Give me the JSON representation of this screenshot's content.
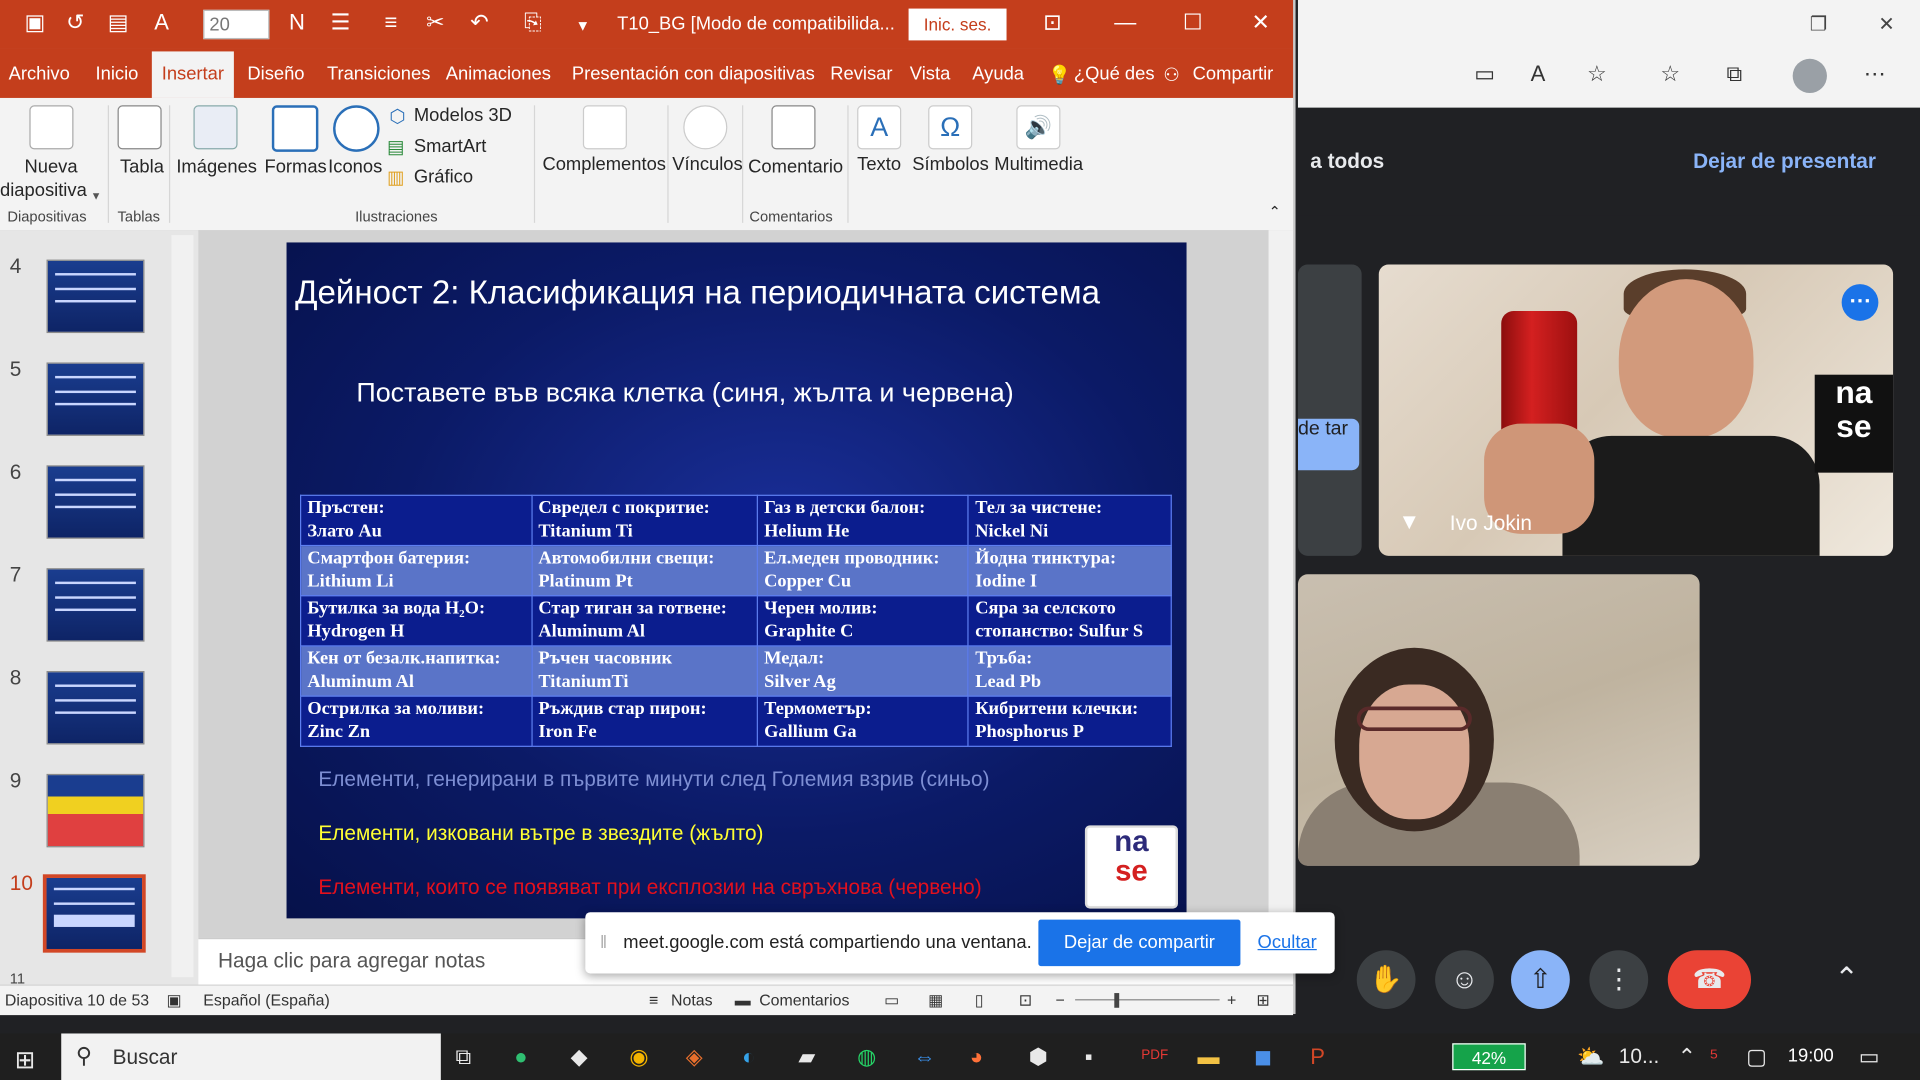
{
  "ppt": {
    "font_size": "20",
    "doc_title": "T10_BG [Modo de compatibilida...",
    "sign_in": "Inic. ses.",
    "tabs": [
      "Archivo",
      "Inicio",
      "Insertar",
      "Diseño",
      "Transiciones",
      "Animaciones",
      "Presentación con diapositivas",
      "Revisar",
      "Vista",
      "Ayuda"
    ],
    "tell_me": "¿Qué des",
    "share": "Compartir",
    "ribbon": {
      "new_slide_1": "Nueva",
      "new_slide_2": "diapositiva",
      "table": "Tabla",
      "images": "Imágenes",
      "shapes": "Formas",
      "icons": "Iconos",
      "models_3d": "Modelos 3D",
      "smartart": "SmartArt",
      "chart": "Gráfico",
      "addins": "Complementos",
      "links": "Vínculos",
      "comment": "Comentario",
      "text": "Texto",
      "symbols": "Símbolos",
      "media": "Multimedia",
      "groups": {
        "slides": "Diapositivas",
        "tables": "Tablas",
        "illustrations": "Ilustraciones",
        "comments": "Comentarios"
      }
    },
    "thumb_numbers": [
      "4",
      "5",
      "6",
      "7",
      "8",
      "9",
      "10",
      "11"
    ],
    "notes_placeholder": "Haga clic para agregar notas",
    "status": {
      "slide_of": "Diapositiva 10 de 53",
      "language": "Español (España)",
      "notes": "Notas",
      "comments": "Comentarios"
    }
  },
  "slide": {
    "title": "Дейност 2: Класификация на периодичната система",
    "subtitle": "Поставете във всяка клетка (синя, жълта и червена)",
    "rows": [
      [
        [
          "Пръстен:",
          "Злато Au"
        ],
        [
          "Свредел с покритие:",
          "Titanium Ti"
        ],
        [
          "Газ в детски балон:",
          "Helium He"
        ],
        [
          "Тел за чистене:",
          "Nickel Ni"
        ]
      ],
      [
        [
          "Смартфон батерия:",
          "Lithium Li"
        ],
        [
          "Автомобилни свещи:",
          "Platinum Pt"
        ],
        [
          "Ел.меден проводник:",
          "Copper Cu"
        ],
        [
          "Йодна тинктура:",
          "Iodine I"
        ]
      ],
      [
        [
          "Бутилка за вода H₂O:",
          "Hydrogen H"
        ],
        [
          "Стар тиган за готвене:",
          "Aluminum Al"
        ],
        [
          "Черен молив:",
          "Graphite C"
        ],
        [
          "Сяра за селското",
          "стопанство: Sulfur  S"
        ]
      ],
      [
        [
          "Кен от безалк.напитка:",
          "Aluminum Al"
        ],
        [
          "Ръчен часовник",
          "TitaniumTi"
        ],
        [
          "Медал:",
          "Silver Ag"
        ],
        [
          "Тръба:",
          "Lead Pb"
        ]
      ],
      [
        [
          "Острилка за моливи:",
          "Zinc Zn"
        ],
        [
          "Ръждив стар пирон:",
          "Iron Fe"
        ],
        [
          "Термометър:",
          "Gallium Ga"
        ],
        [
          "Кибритени клечки:",
          "Phosphorus P"
        ]
      ]
    ],
    "legend_blue": "Елементи, генерирани в първите минути след Големия взрив (синьо)",
    "legend_yellow": "Елементи, изковани вътре в звездите (жълто)",
    "legend_red": "Елементи, които се появяват при експлозии на свръхнова (червено)",
    "logo_line1": "na",
    "logo_line2": "se"
  },
  "meet": {
    "presenting_to_all": "a todos",
    "stop_presenting": "Dejar de presentar",
    "participant_name": "Ivo Jokin",
    "side_chip": "de tar",
    "logo_text": "na se"
  },
  "share_bar": {
    "message": "meet.google.com está compartiendo una ventana.",
    "stop_button": "Dejar de compartir",
    "hide_link": "Ocultar"
  },
  "taskbar": {
    "search": "Buscar",
    "battery": "42%",
    "temp": "10...",
    "time": "19:00"
  },
  "colors": {
    "ppt_accent": "#c43e1c",
    "meet_bg": "#202124",
    "meet_blue": "#8ab4f8",
    "leave_red": "#ea4335",
    "share_blue": "#1a73e8"
  }
}
